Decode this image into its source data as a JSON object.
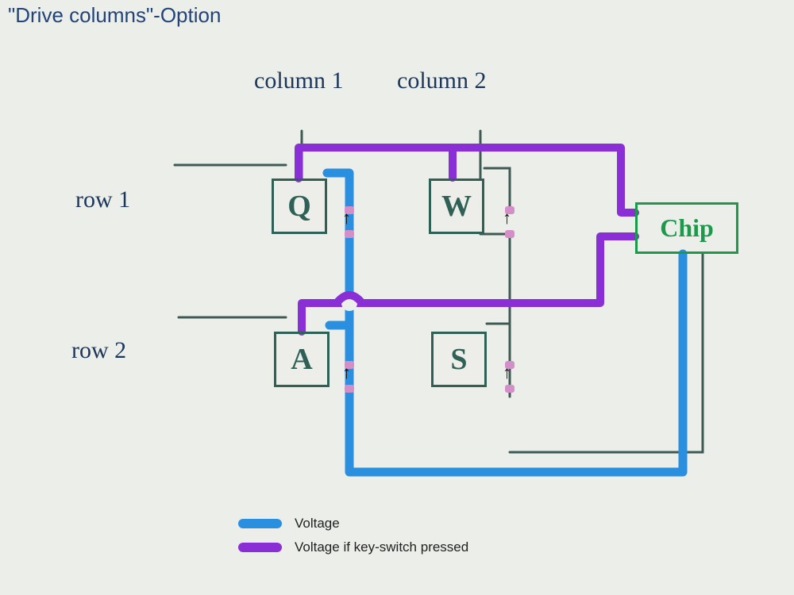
{
  "title": "\"Drive columns\"-Option",
  "columns": {
    "c1": "column 1",
    "c2": "column 2"
  },
  "rows": {
    "r1": "row 1",
    "r2": "row 2"
  },
  "keys": {
    "q": "Q",
    "w": "W",
    "a": "A",
    "s": "S"
  },
  "chip": "Chip",
  "legend": {
    "voltage": "Voltage",
    "voltage_pressed": "Voltage if key-switch pressed"
  },
  "colors": {
    "voltage": "#2b8fe0",
    "voltage_pressed": "#8a2fd6",
    "wire": "#3f5a55",
    "key_border": "#2f6055",
    "chip_border": "#1a9a4a",
    "title": "#23447a"
  },
  "diagram": {
    "type": "keyboard-matrix",
    "drive": "columns",
    "matrix": [
      {
        "row": 1,
        "col": 1,
        "key": "Q"
      },
      {
        "row": 1,
        "col": 2,
        "key": "W"
      },
      {
        "row": 2,
        "col": 1,
        "key": "A"
      },
      {
        "row": 2,
        "col": 2,
        "key": "S"
      }
    ],
    "voltage_path_from": "chip -> column 1 (drives Q and A)",
    "sensed_path_if_pressed": "row 1 and row 2 back to chip",
    "diodes_direction": "column -> row (arrows point toward row line)"
  }
}
